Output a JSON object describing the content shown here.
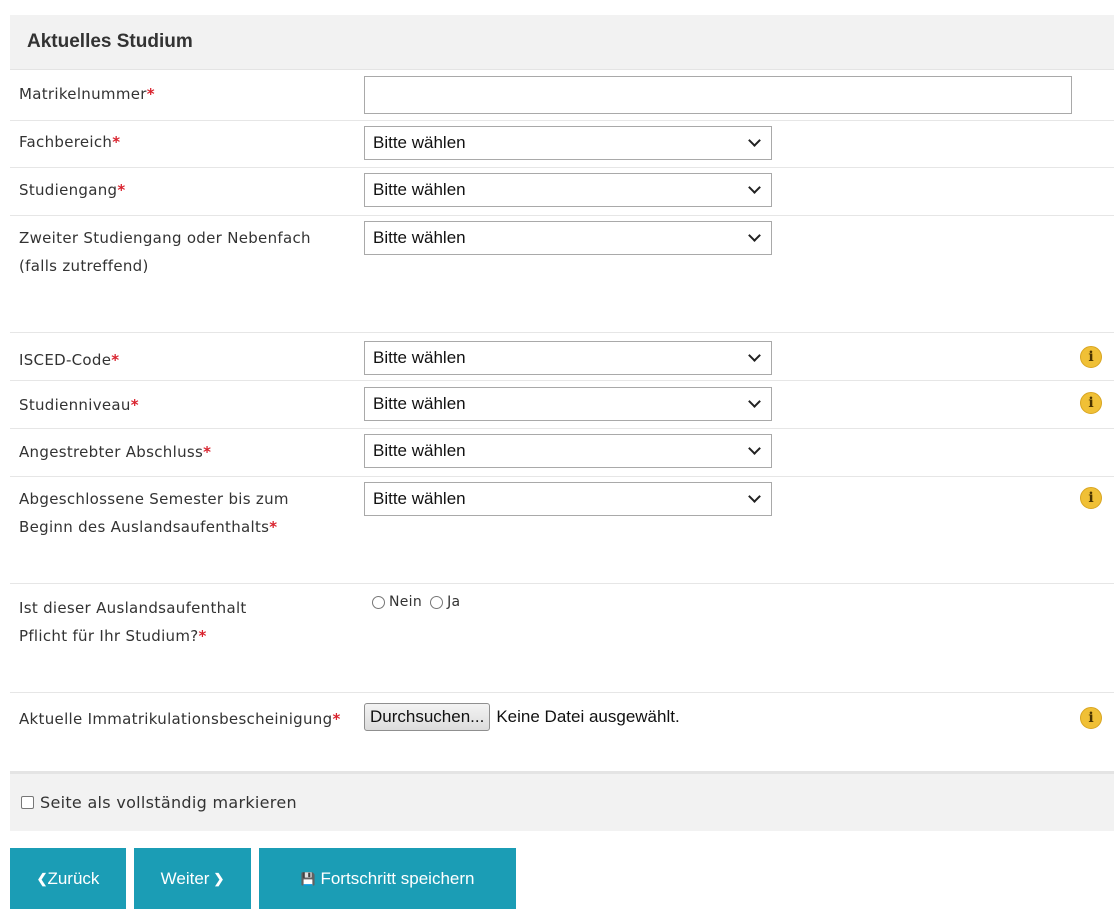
{
  "section": {
    "title": "Aktuelles Studium"
  },
  "fields": {
    "matrikelnummer": {
      "label": "Matrikelnummer",
      "required_mark": "*",
      "value": ""
    },
    "fachbereich": {
      "label": "Fachbereich",
      "required_mark": "*",
      "value": "Bitte wählen"
    },
    "studiengang": {
      "label": "Studiengang",
      "required_mark": "*",
      "value": "Bitte wählen"
    },
    "zweiter_studiengang": {
      "label": "Zweiter Studiengang oder Nebenfach (falls zutreffend)",
      "value": "Bitte wählen"
    },
    "isced": {
      "label": "ISCED-Code",
      "required_mark": "*",
      "value": "Bitte wählen"
    },
    "studienniveau": {
      "label": "Studienniveau",
      "required_mark": "*",
      "value": "Bitte wählen"
    },
    "abschluss": {
      "label": "Angestrebter Abschluss",
      "required_mark": "*",
      "value": "Bitte wählen"
    },
    "semester": {
      "label": "Abgeschlossene Semester bis zum Beginn des Auslandsaufenthalts",
      "required_mark": "*",
      "value": "Bitte wählen"
    },
    "pflicht": {
      "label": "Ist dieser Auslandsaufenthalt Pflicht für Ihr Studium?",
      "required_mark": "*",
      "option_no": "Nein",
      "option_yes": "Ja"
    },
    "immatrikulation": {
      "label": "Aktuelle Immatrikulationsbescheinigung",
      "required_mark": "*",
      "browse_label": "Durchsuchen...",
      "file_status": "Keine Datei ausgewählt."
    }
  },
  "info_icon_glyph": "i",
  "complete": {
    "label": "Seite als vollständig markieren",
    "checked": false
  },
  "buttons": {
    "back": {
      "icon": "❮",
      "label": "Zurück"
    },
    "next": {
      "label": "Weiter",
      "icon": "❯"
    },
    "save": {
      "icon": "💾",
      "label": "Fortschritt speichern"
    }
  },
  "colors": {
    "accent": "#1b9db5",
    "required": "#d9232e",
    "info": "#f0c036",
    "header_bg": "#f2f2f2"
  },
  "icons": {
    "info": "info-circle-icon",
    "back": "chevron-left-icon",
    "next": "chevron-right-icon",
    "save": "floppy-disk-icon",
    "dropdown": "chevron-down-icon"
  }
}
